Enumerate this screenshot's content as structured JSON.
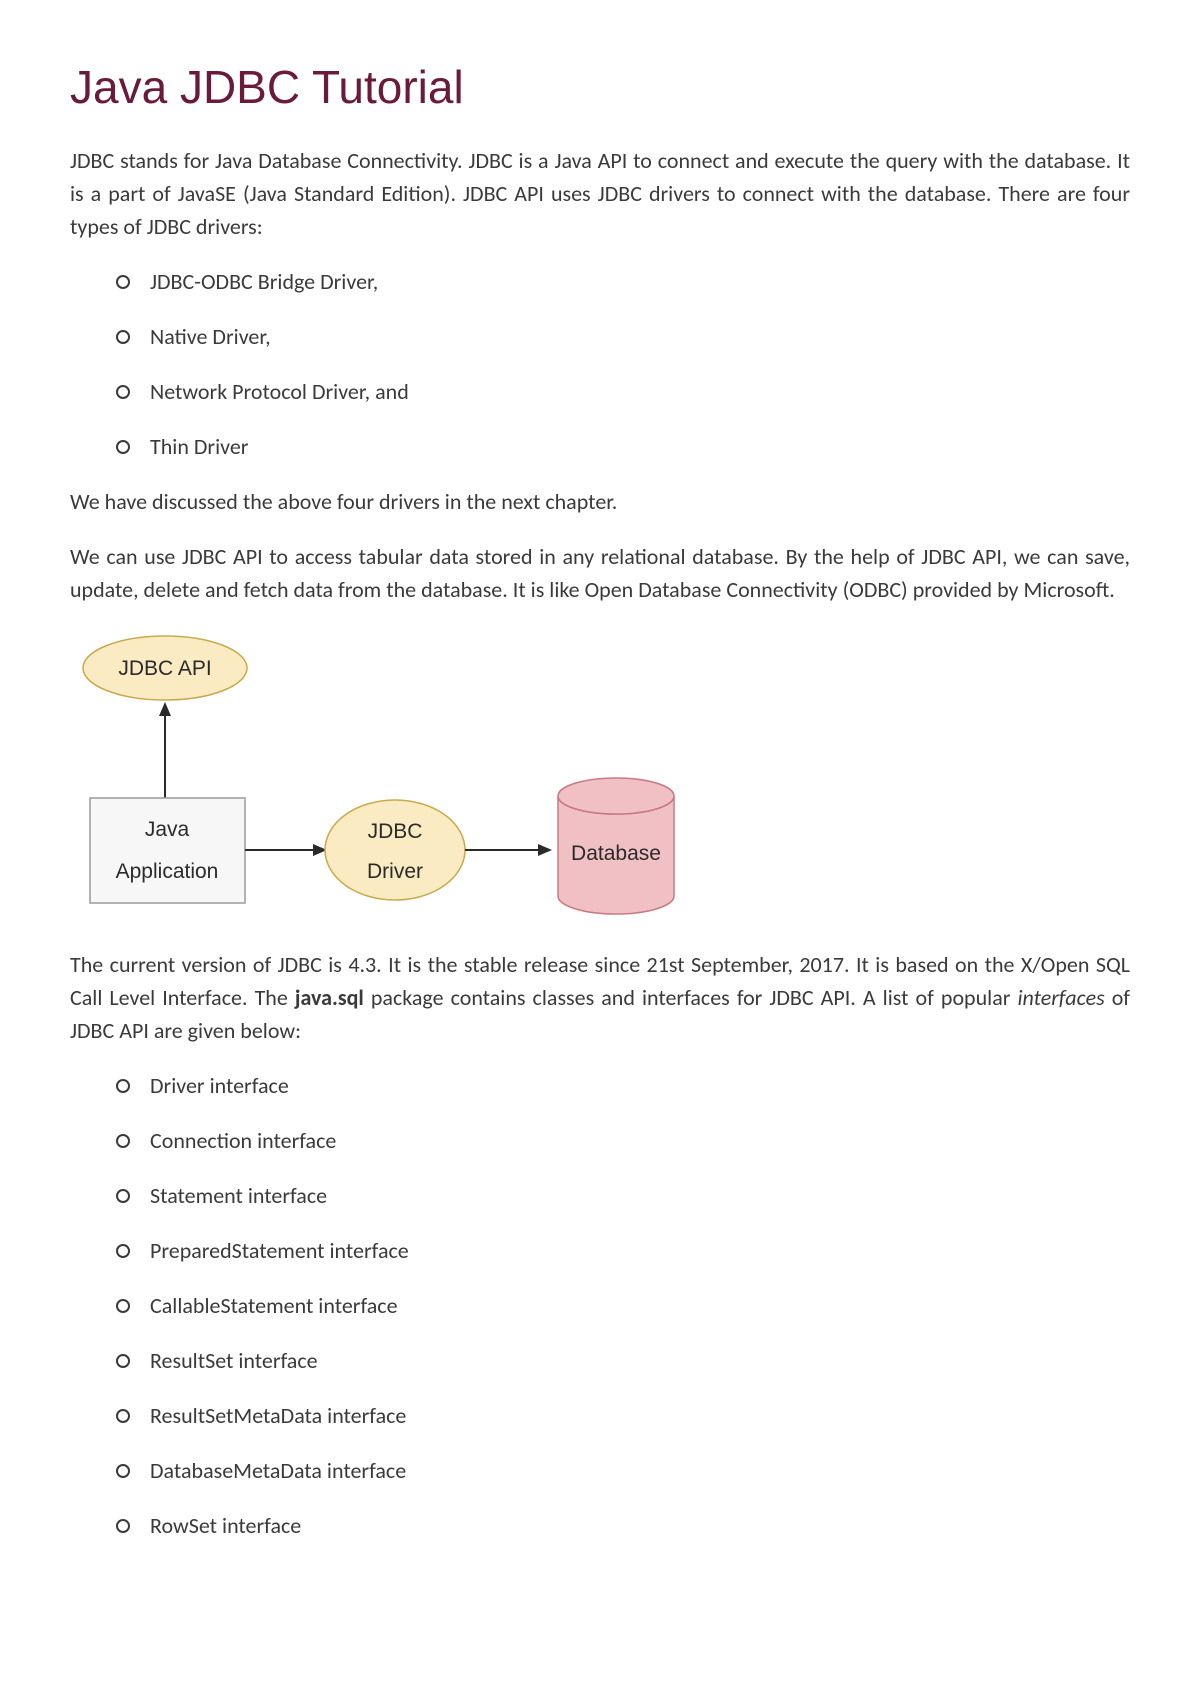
{
  "title": "Java JDBC Tutorial",
  "para1": "JDBC stands for Java Database Connectivity. JDBC is a Java API to connect and execute the query with the database. It is a part of JavaSE (Java Standard Edition). JDBC API uses JDBC drivers to connect with the database. There are four types of JDBC drivers:",
  "drivers": [
    "JDBC-ODBC Bridge Driver,",
    "Native Driver,",
    "Network Protocol Driver, and",
    "Thin Driver"
  ],
  "para2": "We have discussed the above four drivers in the next chapter.",
  "para3": "We can use JDBC API to access tabular data stored in any relational database. By the help of JDBC API, we can save, update, delete and fetch data from the database. It is like Open Database Connectivity (ODBC) provided by Microsoft.",
  "diagram": {
    "api": "JDBC API",
    "app1": "Java",
    "app2": "Application",
    "driver1": "JDBC",
    "driver2": "Driver",
    "db": "Database"
  },
  "para4_a": "The current version of JDBC is 4.3. It is the stable release since 21st September, 2017. It is based on the X/Open SQL Call Level Interface. The ",
  "para4_b": "java.sql",
  "para4_c": " package contains classes and interfaces for JDBC API. A list of popular ",
  "para4_d": "interfaces",
  "para4_e": " of JDBC API are given below:",
  "interfaces": [
    "Driver interface",
    "Connection interface",
    "Statement interface",
    "PreparedStatement interface",
    "CallableStatement interface",
    "ResultSet interface",
    "ResultSetMetaData interface",
    "DatabaseMetaData interface",
    "RowSet interface"
  ]
}
